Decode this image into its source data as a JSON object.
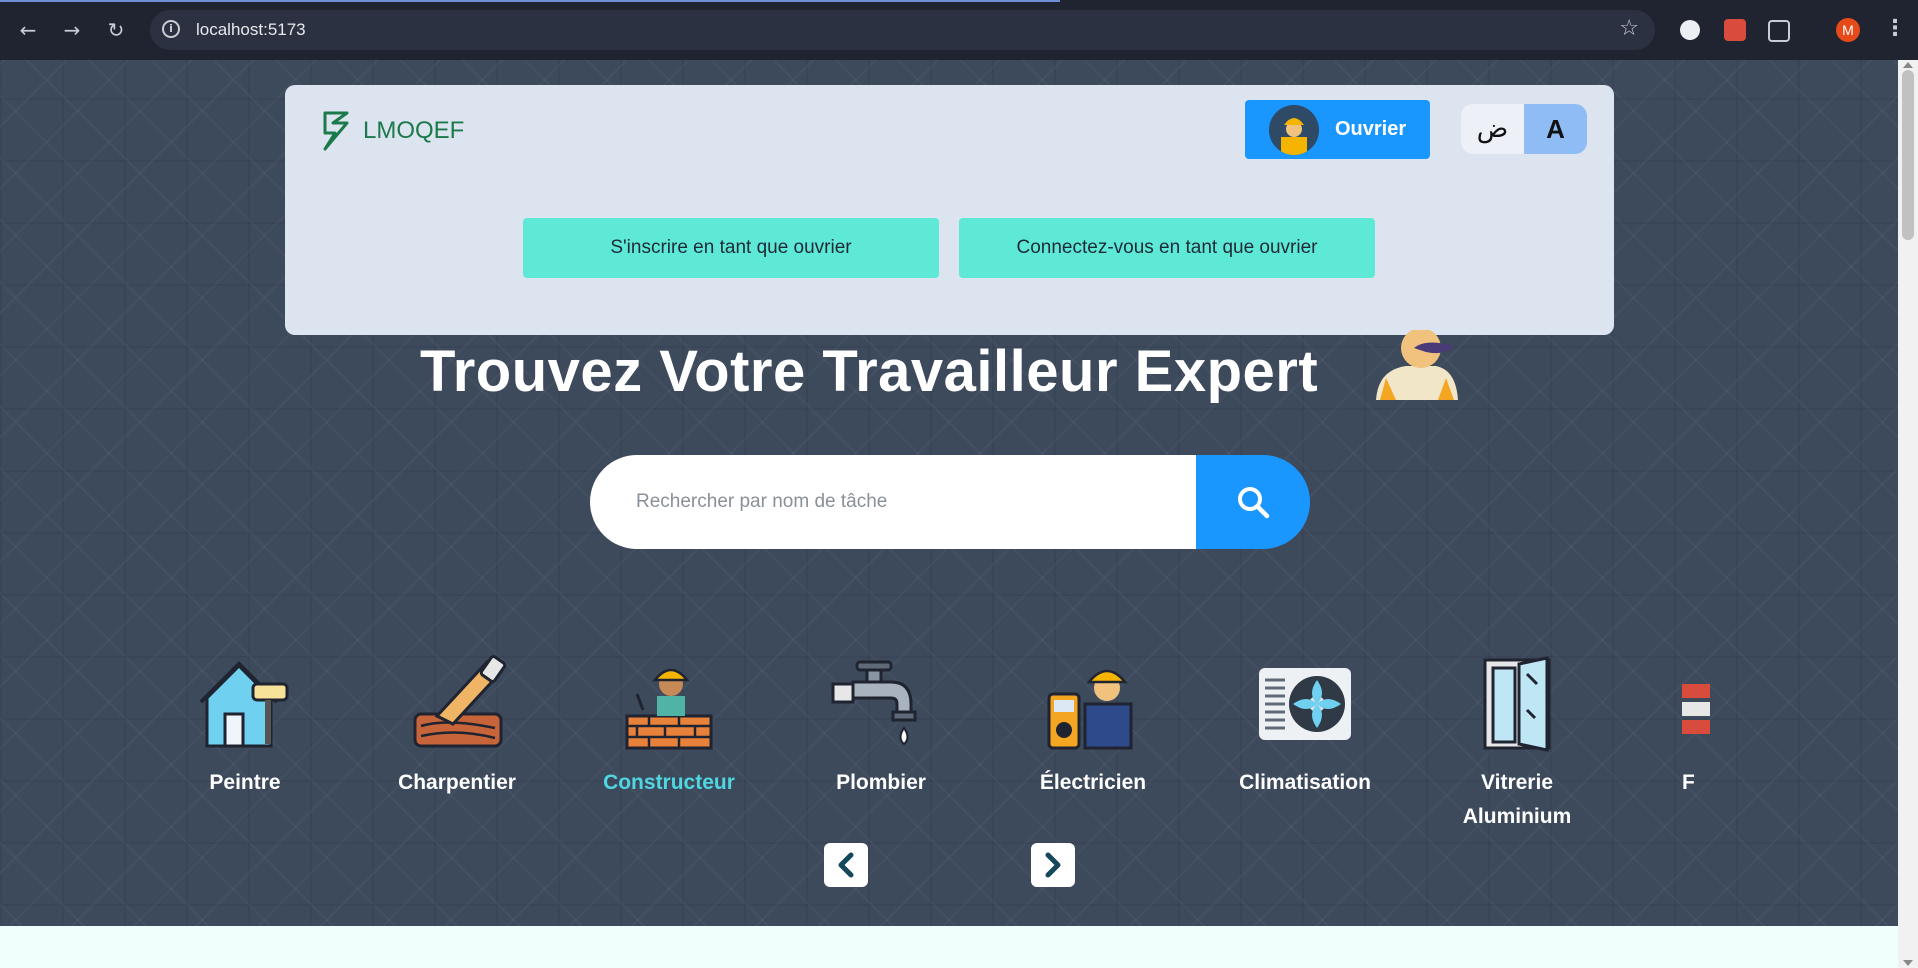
{
  "browser": {
    "url": "localhost:5173",
    "profile_initial": "M"
  },
  "header": {
    "brand": "LMOQEF",
    "worker_button": "Ouvrier",
    "lang_ar": "ض",
    "lang_fr": "A",
    "register_button": "S'inscrire en tant que ouvrier",
    "login_button": "Connectez-vous en tant que ouvrier"
  },
  "hero": {
    "title": "Trouvez Votre Travailleur Expert"
  },
  "search": {
    "placeholder": "Rechercher par nom de tâche"
  },
  "categories": [
    {
      "name": "Peintre",
      "icon": "painter-icon"
    },
    {
      "name": "Charpentier",
      "icon": "carpenter-icon"
    },
    {
      "name": "Constructeur",
      "icon": "builder-icon",
      "active": true
    },
    {
      "name": "Plombier",
      "icon": "plumber-icon"
    },
    {
      "name": "Électricien",
      "icon": "electrician-icon"
    },
    {
      "name": "Climatisation",
      "icon": "air-conditioning-icon"
    },
    {
      "name": "Vitrerie Aluminium",
      "icon": "window-icon"
    },
    {
      "name": "F",
      "icon": "bricks-icon"
    }
  ],
  "colors": {
    "accent_blue": "#1a96ff",
    "accent_teal": "#5ee8d6",
    "active_category": "#4fd6e0",
    "brand_green": "#1b7a4b"
  }
}
